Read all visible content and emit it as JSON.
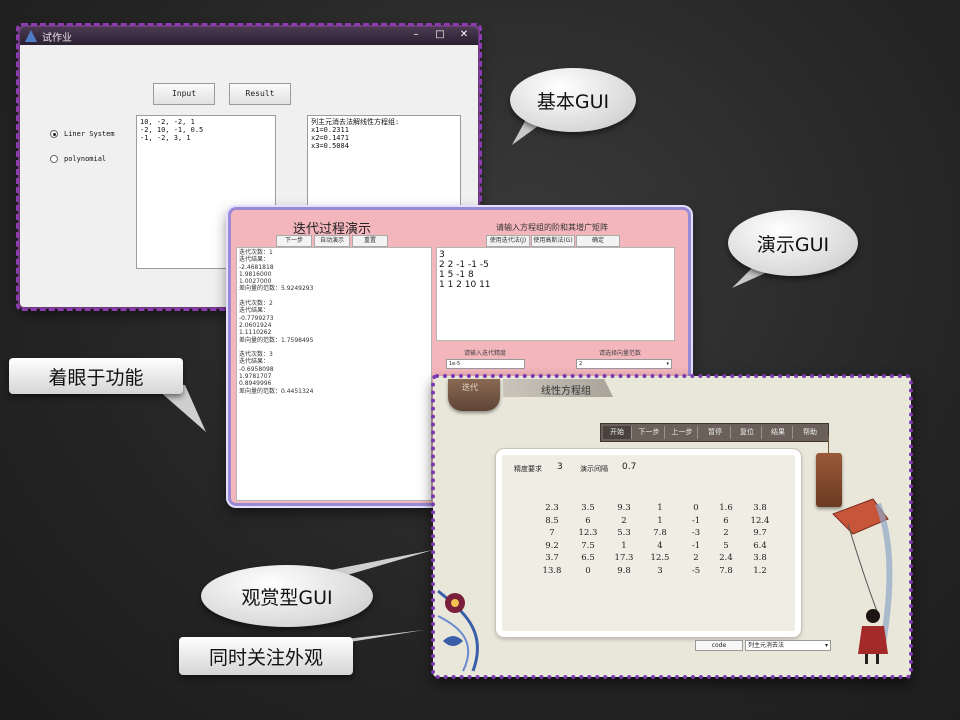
{
  "win1": {
    "title": "试作业",
    "input_btn": "Input",
    "result_btn": "Result",
    "radio1": "Liner System",
    "radio2": "polynomial",
    "input_text": "10, -2, -2, 1\n-2, 10, -1, 0.5\n-1, -2, 3, 1",
    "result_text": "列主元消去法解线性方程组:\nx1=0.2311\nx2=0.1471\nx3=0.5084"
  },
  "win2": {
    "title": "迭代过程演示",
    "prompt": "请输入方程组的阶和其增广矩阵",
    "btn_next": "下一步",
    "btn_auto": "自动演示",
    "btn_reset": "重置",
    "btn_iter": "使用迭代法(J)",
    "btn_gs": "使用高斯法(G)",
    "btn_ok": "确定",
    "log": [
      "迭代次数：1",
      "迭代结果：",
      "  -2.4681818",
      "  1.9816000",
      "  1.0027000",
      "差向量的范数：5.9249293",
      "",
      "迭代次数：2",
      "迭代结果：",
      "  -0.7799273",
      "  2.0601924",
      "  1.1110262",
      "差向量的范数：1.7598495",
      "",
      "迭代次数：3",
      "迭代结果：",
      "  -0.6958098",
      "  1.9781707",
      "  0.8949996",
      "差向量的范数：0.4451324"
    ],
    "matrix": [
      "3",
      "2 2 -1 -1 -5",
      "1 5 -1 8",
      "1 1 2 10 11"
    ],
    "precision_label": "请输入迭代精度",
    "precision_value": "1e-5",
    "norm_label": "请选择向量范数",
    "norm_value": "2"
  },
  "win3": {
    "tag_text": "迭代",
    "tab_title": "线性方程组",
    "toolbar": [
      "开始",
      "下一步",
      "上一步",
      "暂停",
      "复位",
      "结果",
      "帮助"
    ],
    "precision_label": "精度要求",
    "precision_value": "3",
    "interval_label": "演示间隔",
    "interval_value": "0.7",
    "matrix": [
      [
        "2.3",
        "3.5",
        "9.3",
        "1",
        "0",
        "1.6",
        "3.8"
      ],
      [
        "8.5",
        "6",
        "2",
        "1",
        "-1",
        "6",
        "12.4"
      ],
      [
        "7",
        "12.3",
        "5.3",
        "7.8",
        "-3",
        "2",
        "9.7"
      ],
      [
        "9.2",
        "7.5",
        "1",
        "4",
        "-1",
        "5",
        "6.4"
      ],
      [
        "3.7",
        "6.5",
        "17.3",
        "12.5",
        "2",
        "2.4",
        "3.8"
      ],
      [
        "13.8",
        "0",
        "9.8",
        "3",
        "-5",
        "7.8",
        "1.2"
      ]
    ],
    "code_btn": "code",
    "method_select": "列主元消去法"
  },
  "callouts": {
    "basic": "基本GUI",
    "demo": "演示GUI",
    "function": "着眼于功能",
    "visual": "观赏型GUI",
    "appearance": "同时关注外观"
  },
  "colors": {
    "background": "#262626",
    "dash_purple": "#8a3cb0",
    "demo_pink": "#f4b6bd",
    "visual_cream": "#e9e6da"
  }
}
